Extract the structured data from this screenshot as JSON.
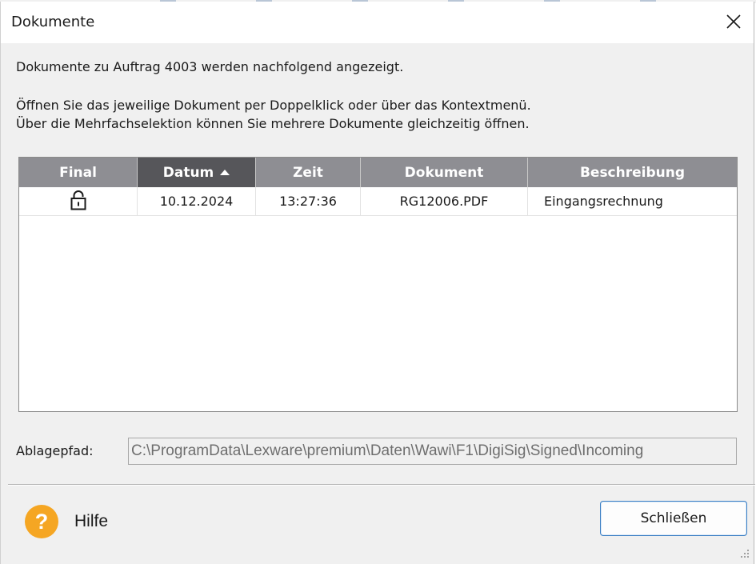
{
  "window": {
    "title": "Dokumente"
  },
  "info": {
    "line1": "Dokumente zu Auftrag 4003 werden nachfolgend angezeigt.",
    "line2": "Öffnen Sie das jeweilige Dokument per Doppelklick oder über das Kontextmenü.",
    "line3": "Über die Mehrfachselektion können Sie mehrere Dokumente gleichzeitig öffnen."
  },
  "table": {
    "columns": [
      "Final",
      "Datum",
      "Zeit",
      "Dokument",
      "Beschreibung"
    ],
    "sorted_column": "Datum",
    "sort_direction": "ascending",
    "rows": [
      {
        "final_icon": "lock-icon",
        "datum": "10.12.2024",
        "zeit": "13:27:36",
        "dokument": "RG12006.PDF",
        "beschreibung": "Eingangsrechnung"
      }
    ]
  },
  "path": {
    "label": "Ablagepfad:",
    "value": "C:\\ProgramData\\Lexware\\premium\\Daten\\Wawi\\F1\\DigiSig\\Signed\\Incoming"
  },
  "footer": {
    "help_icon": "question-icon",
    "help_label": "Hilfe",
    "close_label": "Schließen"
  },
  "colors": {
    "header_bg": "#8e8e93",
    "sorted_header_bg": "#56565a",
    "help_icon_bg": "#f5a623",
    "button_border": "#3b7fc4"
  }
}
